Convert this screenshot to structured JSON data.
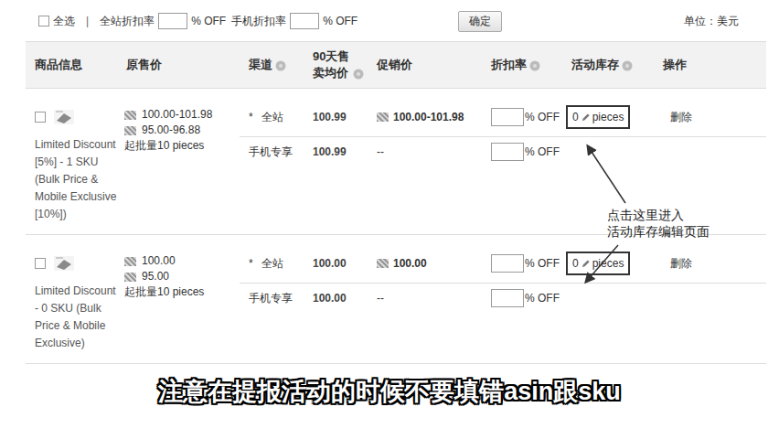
{
  "toolbar": {
    "select_all": {
      "label": "全选",
      "checked": false
    },
    "separator": "|",
    "site_discount": {
      "label": "全站折扣率",
      "value": "",
      "unit": "% OFF"
    },
    "mobile_discount": {
      "label": "手机折扣率",
      "value": "",
      "unit": "% OFF"
    },
    "confirm": "确定",
    "unit_note": "单位：美元"
  },
  "table": {
    "columns": [
      {
        "label": "商品信息",
        "help": false
      },
      {
        "label": "原售价",
        "help": false
      },
      {
        "label": "渠道",
        "help": true
      },
      {
        "label": "90天售卖均价",
        "help": true
      },
      {
        "label": "促销价",
        "help": false
      },
      {
        "label": "折扣率",
        "help": true
      },
      {
        "label": "活动库存",
        "help": true
      },
      {
        "label": "操作",
        "help": false
      }
    ],
    "required_mark": "*",
    "rows": [
      {
        "checked": false,
        "title": "Limited Discount [5%] - 1 SKU (Bulk Price & Mobile Exclusive [10%])",
        "prices": [
          "100.00-101.98",
          "95.00-96.88"
        ],
        "min_order": "起批量10 pieces",
        "action": "删除",
        "channels": [
          {
            "name": "全站",
            "required": true,
            "avg_price": "100.99",
            "promo_price": "100.00-101.98",
            "promo_icon": true,
            "discount": "",
            "discount_unit": "% OFF",
            "stock": "0",
            "stock_unit": "pieces"
          },
          {
            "name": "手机专享",
            "required": false,
            "avg_price": "100.99",
            "promo_price": "--",
            "promo_icon": false,
            "discount": "",
            "discount_unit": "% OFF",
            "stock": "",
            "stock_unit": ""
          }
        ]
      },
      {
        "checked": false,
        "title": "Limited Discount - 0 SKU (Bulk Price & Mobile Exclusive)",
        "prices": [
          "100.00",
          "95.00"
        ],
        "min_order": "起批量10 pieces",
        "action": "删除",
        "channels": [
          {
            "name": "全站",
            "required": true,
            "avg_price": "100.00",
            "promo_price": "100.00",
            "promo_icon": true,
            "discount": "",
            "discount_unit": "% OFF",
            "stock": "0",
            "stock_unit": "pieces"
          },
          {
            "name": "手机专享",
            "required": false,
            "avg_price": "100.00",
            "promo_price": "--",
            "promo_icon": false,
            "discount": "",
            "discount_unit": "% OFF",
            "stock": "",
            "stock_unit": ""
          }
        ]
      }
    ]
  },
  "annotation": {
    "lines": [
      "点击这里进入",
      "活动库存编辑页面"
    ]
  },
  "caption": "注意在提报活动的时候不要填错asin跟sku"
}
